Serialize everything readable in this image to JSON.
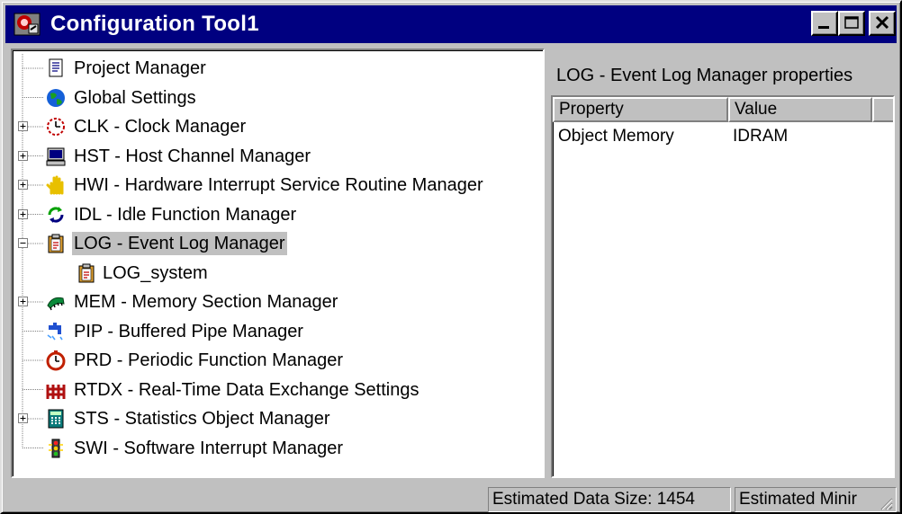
{
  "window": {
    "title": "Configuration Tool1"
  },
  "tree": {
    "items": [
      {
        "label": "Project Manager",
        "icon": "document-icon",
        "expander": "none",
        "indent": 0
      },
      {
        "label": "Global Settings",
        "icon": "globe-icon",
        "expander": "none",
        "indent": 0
      },
      {
        "label": "CLK - Clock Manager",
        "icon": "clock-icon",
        "expander": "plus",
        "indent": 0
      },
      {
        "label": "HST - Host Channel Manager",
        "icon": "computer-icon",
        "expander": "plus",
        "indent": 0
      },
      {
        "label": "HWI - Hardware Interrupt Service Routine Manager",
        "icon": "hand-icon",
        "expander": "plus",
        "indent": 0
      },
      {
        "label": "IDL - Idle Function Manager",
        "icon": "cycle-arrows-icon",
        "expander": "plus",
        "indent": 0
      },
      {
        "label": "LOG - Event Log Manager",
        "icon": "clipboard-icon",
        "expander": "minus",
        "indent": 0,
        "selected": true
      },
      {
        "label": "LOG_system",
        "icon": "clipboard-icon",
        "expander": "none",
        "indent": 1
      },
      {
        "label": "MEM - Memory Section Manager",
        "icon": "memory-chip-icon",
        "expander": "plus",
        "indent": 0
      },
      {
        "label": "PIP - Buffered Pipe Manager",
        "icon": "faucet-icon",
        "expander": "none",
        "indent": 0
      },
      {
        "label": "PRD - Periodic Function Manager",
        "icon": "stopwatch-icon",
        "expander": "none",
        "indent": 0
      },
      {
        "label": "RTDX - Real-Time Data Exchange Settings",
        "icon": "rtdx-icon",
        "expander": "none",
        "indent": 0
      },
      {
        "label": "STS - Statistics Object Manager",
        "icon": "calculator-icon",
        "expander": "plus",
        "indent": 0
      },
      {
        "label": "SWI - Software Interrupt Manager",
        "icon": "traffic-light-icon",
        "expander": "none",
        "indent": 0
      }
    ]
  },
  "properties": {
    "title": "LOG - Event Log Manager properties",
    "columns": {
      "property": "Property",
      "value": "Value"
    },
    "rows": [
      {
        "property": "Object Memory",
        "value": "IDRAM"
      }
    ]
  },
  "statusbar": {
    "data_size": "Estimated Data Size: 1454",
    "min": "Estimated Minir"
  },
  "colors": {
    "titlebar": "#000080",
    "face": "#c0c0c0",
    "selection": "#c0c0c0"
  }
}
